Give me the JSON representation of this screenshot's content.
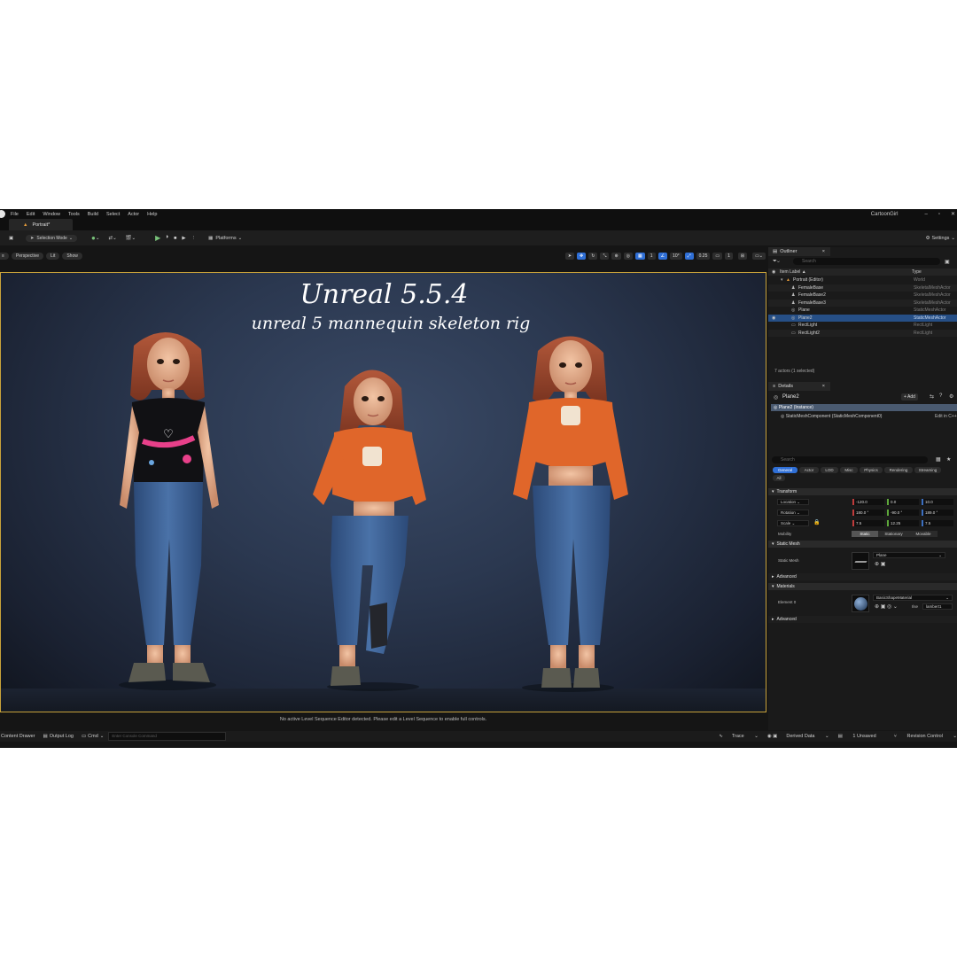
{
  "app": {
    "project_name": "CartoonGirl",
    "menu": [
      "File",
      "Edit",
      "Window",
      "Tools",
      "Build",
      "Select",
      "Actor",
      "Help"
    ],
    "document_tab": "Portrait*"
  },
  "toolbar": {
    "mode_label": "Selection Mode",
    "platforms_label": "Platforms",
    "settings_label": "Settings"
  },
  "viewport": {
    "perspective_label": "Perspective",
    "lit_label": "Lit",
    "show_label": "Show",
    "grid_value": "1",
    "angle_value": "10°",
    "scale_value": "0.25",
    "camera_speed": "1",
    "title": "Unreal 5.5.4",
    "subtitle": "unreal 5 mannequin skeleton rig",
    "status_message": "No active Level Sequence Editor detected. Please edit a Level Sequence to enable full controls."
  },
  "outliner": {
    "tab_label": "Outliner",
    "search_placeholder": "Search",
    "col_label": "Item Label ▲",
    "col_type": "Type",
    "rows": [
      {
        "label": "Portrait (Editor)",
        "type": "World"
      },
      {
        "label": "FemaleBase",
        "type": "SkeletalMeshActor"
      },
      {
        "label": "FemaleBase2",
        "type": "SkeletalMeshActor"
      },
      {
        "label": "FemaleBase3",
        "type": "SkeletalMeshActor"
      },
      {
        "label": "Plane",
        "type": "StaticMeshActor"
      },
      {
        "label": "Plane2",
        "type": "StaticMeshActor"
      },
      {
        "label": "RectLight",
        "type": "RectLight"
      },
      {
        "label": "RectLight2",
        "type": "RectLight"
      }
    ],
    "selected_index": 5,
    "summary": "7 actors (1 selected)"
  },
  "details": {
    "tab_label": "Details",
    "object_name": "Plane2",
    "add_label": "+ Add",
    "instance_label": "Plane2 (Instance)",
    "component_label": "StaticMeshComponent (StaticMeshComponent0)",
    "edit_label": "Edit in C++",
    "search_placeholder": "Search",
    "filter_tabs": [
      "General",
      "Actor",
      "LOD",
      "Misc",
      "Physics",
      "Rendering",
      "Streaming",
      "All"
    ],
    "transform_header": "Transform",
    "location_label": "Location",
    "location": [
      "-120.0",
      "0.0",
      "10.0"
    ],
    "rotation_label": "Rotation",
    "rotation": [
      "180.0 °",
      "-90.0 °",
      "189.0 °"
    ],
    "scale_label": "Scale",
    "scale": [
      "7.5",
      "12.25",
      "7.5"
    ],
    "mobility_label": "Mobility",
    "mobility_options": [
      "Static",
      "Stationary",
      "Movable"
    ],
    "static_mesh_header": "Static Mesh",
    "static_mesh_label": "Static Mesh",
    "static_mesh_value": "Plane",
    "advanced_label": "Advanced",
    "materials_header": "Materials",
    "element_label": "Element 0",
    "material_value": "BasicShapeMaterial",
    "material_source": "Ilse",
    "material_extra": "lambert1",
    "advanced2_label": "Advanced"
  },
  "statusbar": {
    "content_drawer": "Content Drawer",
    "output_log": "Output Log",
    "cmd_label": "Cmd",
    "cmd_placeholder": "Enter Console Command",
    "trace_label": "Trace",
    "derived_data": "Derived Data",
    "unsaved": "1 Unsaved",
    "revision_control": "Revision Control"
  },
  "colors": {
    "accent_blue": "#2f6fd6",
    "selection_blue": "#264f86",
    "viewport_border": "#c8a23a",
    "shirt_orange": "#e0662a",
    "jeans_blue": "#3a5f95"
  }
}
